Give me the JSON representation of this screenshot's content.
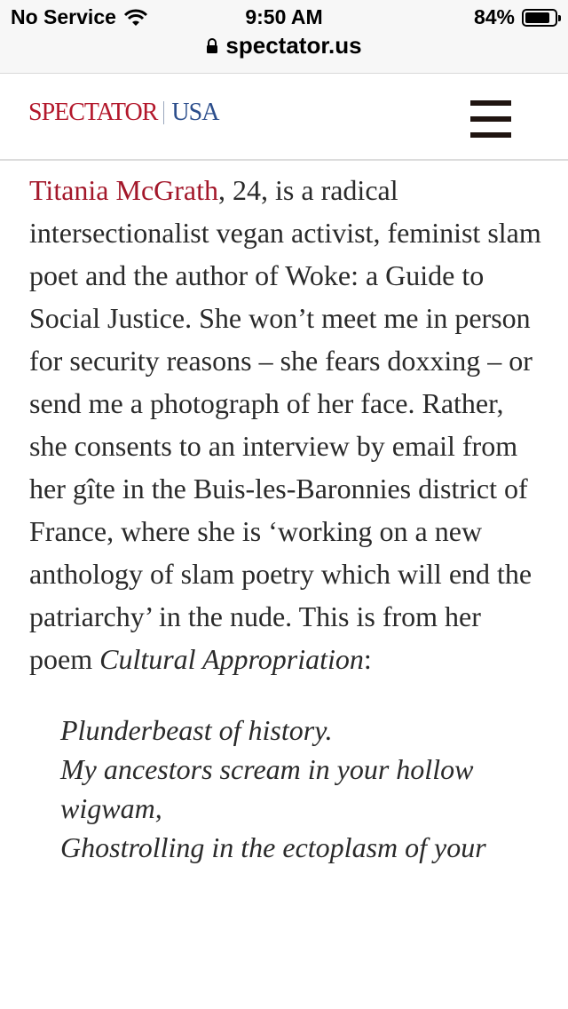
{
  "status_bar": {
    "carrier": "No Service",
    "time": "9:50 AM",
    "battery_percent": "84%",
    "battery_level": 0.84,
    "url": "spectator.us"
  },
  "header": {
    "logo_main": "SPECTATOR",
    "logo_sub": "USA",
    "menu_icon": "hamburger-menu-icon",
    "colors": {
      "logo_red": "#b3172b",
      "logo_blue": "#2c4e8c"
    }
  },
  "article": {
    "author_link": "Titania McGrath",
    "body_text": ", 24, is a radical intersectionalist vegan activist, feminist slam poet and the author of Woke: a Guide to Social Justice. She won’t meet me in person for security reasons – she fears doxxing – or send me a photograph of her face. Rather, she consents to an interview by email from her gîte in the Buis-les-Baronnies district of France, where she is ‘working on a new anthology of slam poetry which will end the patriarchy’ in the nude. This is from her poem ",
    "poem_title": "Cultural Appropriation",
    "poem_title_suffix": ":",
    "poem_lines": [
      "Plunderbeast of history.",
      "My ancestors scream in your hollow wigwam,",
      "Ghostrolling in the ectoplasm of your"
    ]
  }
}
